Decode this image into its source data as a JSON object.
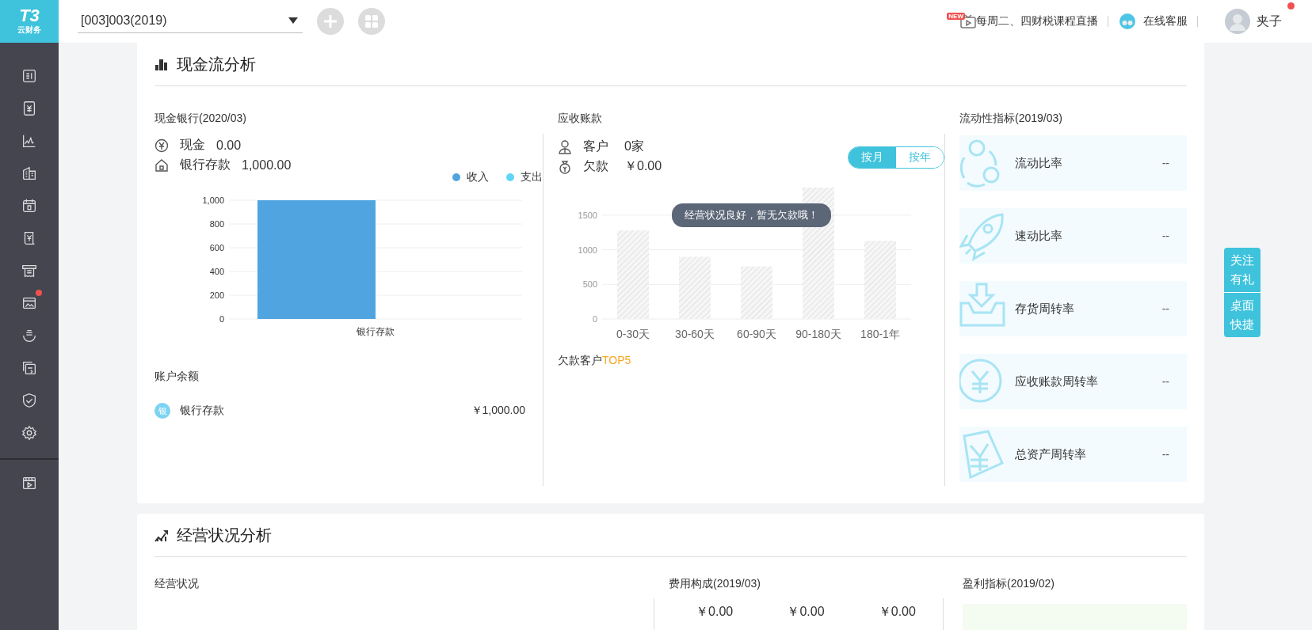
{
  "header": {
    "logo": {
      "title": "T3",
      "subtitle": "云财务"
    },
    "account_select": {
      "value": "[003]003(2019)"
    },
    "live_course": {
      "badge": "NEW",
      "label": "每周二、四财税课程直播"
    },
    "support": {
      "label": "在线客服"
    },
    "user": {
      "name": "夹子",
      "notification": true
    }
  },
  "sidebar": {
    "items": [
      {
        "badge": false
      },
      {
        "badge": false
      },
      {
        "badge": false
      },
      {
        "badge": false
      },
      {
        "badge": false
      },
      {
        "badge": false
      },
      {
        "badge": false
      },
      {
        "badge": true
      },
      {
        "badge": false
      },
      {
        "badge": false
      },
      {
        "badge": false
      },
      {
        "badge": false
      }
    ],
    "footer_items": [
      {
        "badge": false
      }
    ]
  },
  "cash_flow": {
    "title": "现金流分析",
    "cash_bank": {
      "title": "现金银行(2020/03)",
      "cash": {
        "label": "现金",
        "value": "0.00"
      },
      "bank": {
        "label": "银行存款",
        "value": "1,000.00"
      },
      "chart_data": {
        "type": "bar",
        "categories": [
          "银行存款"
        ],
        "series": [
          {
            "name": "收入",
            "color": "#50a5e0",
            "values": [
              1000
            ]
          },
          {
            "name": "支出",
            "color": "#5fd6f7",
            "values": [
              0
            ]
          }
        ],
        "ylim": [
          0,
          1000
        ],
        "grid": true,
        "yticks": [
          {
            "value": 0,
            "label": "0"
          },
          {
            "value": 200,
            "label": "200"
          },
          {
            "value": 400,
            "label": "400"
          },
          {
            "value": 600,
            "label": "600"
          },
          {
            "value": 800,
            "label": "800"
          },
          {
            "value": 1000,
            "label": "1,000"
          }
        ]
      },
      "balance_title": "账户余额",
      "balances": [
        {
          "badge": "银",
          "name": "银行存款",
          "amount": "￥1,000.00"
        }
      ]
    },
    "receivables": {
      "title": "应收账款",
      "customers": {
        "label": "客户",
        "value": "0家"
      },
      "debt": {
        "label": "欠款",
        "value": "￥0.00"
      },
      "toggle": [
        {
          "label": "按月",
          "selected": true
        },
        {
          "label": "按年",
          "selected": false
        }
      ],
      "chart_data": {
        "type": "bar",
        "categories": [
          "0-30天",
          "30-60天",
          "60-90天",
          "90-180天",
          "180-1年"
        ],
        "values": [
          1280,
          900,
          760,
          1900,
          1130
        ],
        "ylim": [
          0,
          1900
        ],
        "grid": true,
        "yticks": [
          0,
          500,
          1000,
          1500
        ]
      },
      "tooltip": "经营状况良好，暂无欠款哦！",
      "top_title": "欠款客户**TOP5**"
    },
    "liquidity": {
      "title": "流动性指标(2019/03)",
      "items": [
        {
          "label": "流动比率",
          "value": "--"
        },
        {
          "label": "速动比率",
          "value": "--"
        },
        {
          "label": "存货周转率",
          "value": "--"
        },
        {
          "label": "应收账款周转率",
          "value": "--"
        },
        {
          "label": "总资产周转率",
          "value": "--"
        }
      ]
    }
  },
  "operations": {
    "title": "经营状况分析",
    "status_title": "经营状况",
    "expense": {
      "title": "费用构成(2019/03)",
      "values": [
        "￥0.00",
        "￥0.00",
        "￥0.00"
      ]
    },
    "profit": {
      "title": "盈利指标(2019/02)"
    }
  },
  "side_widget": {
    "buttons": [
      "关注有礼",
      "桌面快捷"
    ]
  }
}
